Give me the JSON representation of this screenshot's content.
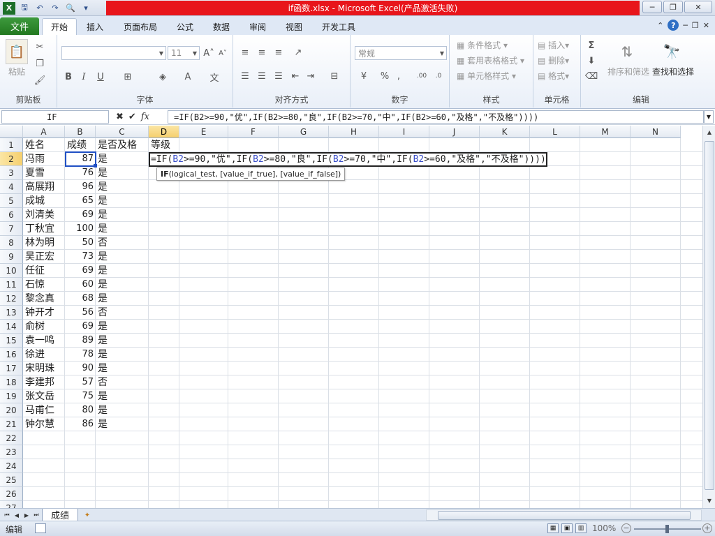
{
  "window": {
    "title": "if函数.xlsx  -  Microsoft Excel(产品激活失败)",
    "qat": [
      "save-icon",
      "undo-icon",
      "redo-icon",
      "print-preview-icon",
      "customize-icon"
    ],
    "controls": [
      "minimize-icon",
      "restore-icon",
      "close-icon"
    ]
  },
  "ribbon": {
    "file_tab": "文件",
    "tabs": [
      "开始",
      "插入",
      "页面布局",
      "公式",
      "数据",
      "审阅",
      "视图",
      "开发工具"
    ],
    "active_tab": "开始",
    "groups": {
      "clipboard": {
        "label": "剪贴板",
        "paste": "粘贴"
      },
      "font": {
        "label": "字体",
        "font_name": "",
        "font_size": "11"
      },
      "alignment": {
        "label": "对齐方式"
      },
      "number": {
        "label": "数字",
        "format": "常规"
      },
      "styles": {
        "label": "样式",
        "items": [
          "条件格式",
          "套用表格格式",
          "单元格样式"
        ]
      },
      "cells": {
        "label": "单元格",
        "items": [
          "插入",
          "删除",
          "格式"
        ]
      },
      "editing": {
        "label": "编辑",
        "sort": "排序和筛选",
        "find": "查找和选择"
      }
    }
  },
  "formula_bar": {
    "name_box": "IF",
    "fx": "fx",
    "formula": "=IF(B2>=90,\"优\",IF(B2>=80,\"良\",IF(B2>=70,\"中\",IF(B2>=60,\"及格\",\"不及格\"))))"
  },
  "sheet": {
    "columns": [
      "A",
      "B",
      "C",
      "D",
      "E",
      "F",
      "G",
      "H",
      "I",
      "J",
      "K",
      "L",
      "M",
      "N"
    ],
    "selected_column": "D",
    "selected_row": 2,
    "rows": [
      "1",
      "2",
      "3",
      "4",
      "5",
      "6",
      "7",
      "8",
      "9",
      "10",
      "11",
      "12",
      "13",
      "14",
      "15",
      "16",
      "17",
      "18",
      "19",
      "20",
      "21",
      "22",
      "23",
      "24",
      "25",
      "26",
      "27"
    ],
    "headers": [
      "姓名",
      "成绩",
      "是否及格",
      "等级"
    ],
    "data": [
      [
        "冯雨",
        "87",
        "是"
      ],
      [
        "夏雪",
        "76",
        "是"
      ],
      [
        "高展翔",
        "96",
        "是"
      ],
      [
        "成城",
        "65",
        "是"
      ],
      [
        "刘清美",
        "69",
        "是"
      ],
      [
        "丁秋宜",
        "100",
        "是"
      ],
      [
        "林为明",
        "50",
        "否"
      ],
      [
        "吴正宏",
        "73",
        "是"
      ],
      [
        "任征",
        "69",
        "是"
      ],
      [
        "石惊",
        "60",
        "是"
      ],
      [
        "黎念真",
        "68",
        "是"
      ],
      [
        "钟开才",
        "56",
        "否"
      ],
      [
        "俞树",
        "69",
        "是"
      ],
      [
        "袁一鸣",
        "89",
        "是"
      ],
      [
        "徐进",
        "78",
        "是"
      ],
      [
        "宋明珠",
        "90",
        "是"
      ],
      [
        "李建邦",
        "57",
        "否"
      ],
      [
        "张文岳",
        "75",
        "是"
      ],
      [
        "马甫仁",
        "80",
        "是"
      ],
      [
        "钟尔慧",
        "86",
        "是"
      ]
    ],
    "editing_formula_parts": [
      "=IF",
      "(",
      "B2",
      ">=90,\"优\",IF(",
      "B2",
      ">=80,\"良\",IF(",
      "B2",
      ">=70,\"中\",IF(",
      "B2",
      ">=60,\"及格\",\"不及格\"))))"
    ],
    "tooltip": {
      "fn": "IF",
      "args": "(logical_test, [value_if_true], [value_if_false])"
    }
  },
  "sheet_tabs": [
    "成绩"
  ],
  "status_bar": {
    "mode": "编辑",
    "zoom": "100%"
  },
  "colors": {
    "title_red": "#e8151b",
    "file_tab_green": "#2f8a2c",
    "selection_blue": "#1f4fc4",
    "ref_blue": "#3a4fc9"
  }
}
